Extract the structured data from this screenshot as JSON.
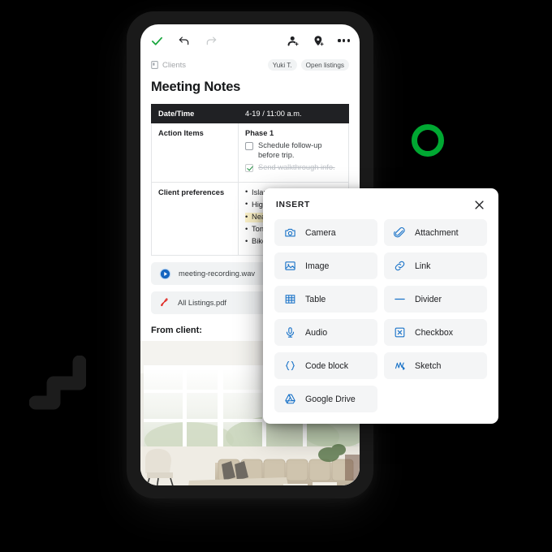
{
  "theme": {
    "background": "#000000",
    "accent_green": "#00a832",
    "check_green": "#1e8e3e",
    "icon_blue": "#1a73c8",
    "highlight_yellow": "#fdf3c9",
    "table_header_bg": "#202124",
    "chip_bg": "#f1f3f4"
  },
  "decor": {
    "ring_name": "green-ring",
    "zigzag_name": "dark-zigzag"
  },
  "toolbar": {
    "done_icon": "check-icon",
    "undo_icon": "undo-icon",
    "redo_icon": "redo-icon",
    "add_person_icon": "add-person-icon",
    "add_location_icon": "add-location-icon",
    "more_icon": "more-options-icon"
  },
  "breadcrumb": {
    "folder_icon": "notebook-icon",
    "label": "Clients"
  },
  "chips": [
    {
      "label": "Yuki T."
    },
    {
      "label": "Open listings"
    }
  ],
  "note": {
    "title": "Meeting Notes",
    "table": {
      "rows": [
        {
          "label": "Date/Time",
          "value": "4-19 / 11:00 a.m.",
          "header": true
        },
        {
          "label": "Action Items",
          "phase": "Phase 1"
        },
        {
          "label": "Client preferences"
        }
      ],
      "action_items": [
        {
          "text": "Schedule follow-up before trip.",
          "checked": false
        },
        {
          "text": "Send walkthrough info.",
          "checked": true
        }
      ],
      "preferences": [
        {
          "text": "Island kitchen",
          "highlight": false
        },
        {
          "text": "High ceilings",
          "highlight": false
        },
        {
          "text": "Near middle school",
          "highlight": true
        },
        {
          "text": "Tons of natural light",
          "highlight": false
        },
        {
          "text": "Bike-friendly streets",
          "highlight": false
        }
      ]
    },
    "attachments": [
      {
        "name": "meeting-recording.wav",
        "icon": "play-circle-icon"
      },
      {
        "name": "All Listings.pdf",
        "icon": "pdf-icon"
      }
    ],
    "from_client_label": "From client:",
    "photo_alt": "living-room-photo"
  },
  "insert_panel": {
    "title": "INSERT",
    "close_icon": "close-icon",
    "items": [
      {
        "label": "Camera",
        "icon": "camera-icon"
      },
      {
        "label": "Attachment",
        "icon": "paperclip-icon"
      },
      {
        "label": "Image",
        "icon": "image-icon"
      },
      {
        "label": "Link",
        "icon": "link-icon"
      },
      {
        "label": "Table",
        "icon": "table-icon"
      },
      {
        "label": "Divider",
        "icon": "divider-icon"
      },
      {
        "label": "Audio",
        "icon": "microphone-icon"
      },
      {
        "label": "Checkbox",
        "icon": "checkbox-icon"
      },
      {
        "label": "Code block",
        "icon": "code-braces-icon"
      },
      {
        "label": "Sketch",
        "icon": "sketch-icon"
      },
      {
        "label": "Google Drive",
        "icon": "google-drive-icon"
      }
    ]
  }
}
